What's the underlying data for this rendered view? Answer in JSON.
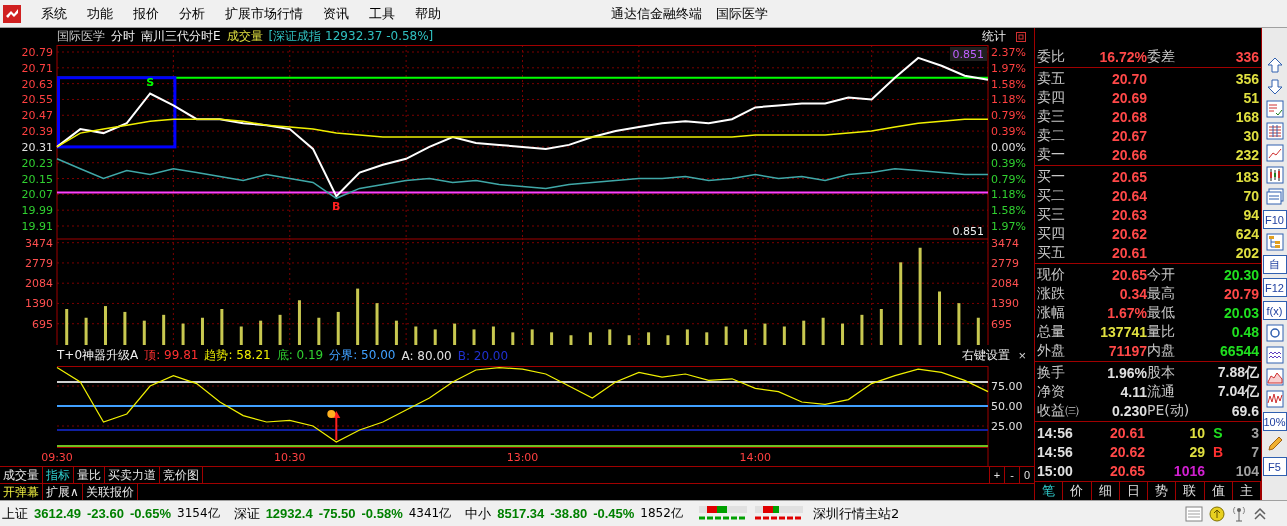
{
  "menu": {
    "items": [
      "系统",
      "功能",
      "报价",
      "分析",
      "扩展市场行情",
      "资讯",
      "工具",
      "帮助"
    ],
    "title": "通达信金融终端",
    "stock": "国际医学"
  },
  "chart_header": {
    "stock": "国际医学",
    "mode": "分时",
    "indicator": "南川三代分时E",
    "volume_label": "成交量",
    "index_overlay": "[深证成指 12932.37 -0.58%]",
    "stats_label": "统计"
  },
  "price_chart": {
    "top_reading": "0.851",
    "bottom_reading": "0.851",
    "pct_ticks": [
      {
        "label": "2.37%",
        "color": "#ff4040"
      },
      {
        "label": "1.97%",
        "color": "#ff4040"
      },
      {
        "label": "1.58%",
        "color": "#ff4040"
      },
      {
        "label": "1.18%",
        "color": "#ff4040"
      },
      {
        "label": "0.79%",
        "color": "#ff4040"
      },
      {
        "label": "0.39%",
        "color": "#ff4040"
      },
      {
        "label": "0.00%",
        "color": "#e0e0e0"
      },
      {
        "label": "0.39%",
        "color": "#30d030"
      },
      {
        "label": "0.79%",
        "color": "#30d030"
      },
      {
        "label": "1.18%",
        "color": "#30d030"
      },
      {
        "label": "1.58%",
        "color": "#30d030"
      },
      {
        "label": "1.97%",
        "color": "#30d030"
      }
    ],
    "signals": [
      {
        "label": "S",
        "color": "#00ff00"
      },
      {
        "label": "B",
        "color": "#ff2020"
      }
    ],
    "chart_data": {
      "type": "line",
      "grid": true,
      "categories": [
        null,
        null,
        null,
        null,
        null,
        null,
        null,
        null,
        null,
        null,
        null,
        null,
        null,
        null,
        null,
        null,
        null,
        null,
        null,
        null,
        null,
        null,
        null,
        null,
        null,
        null,
        null,
        null,
        null,
        null,
        null,
        null,
        null,
        null,
        null,
        null,
        null,
        null,
        null,
        null,
        null
      ],
      "ylim": [
        19.91,
        20.79
      ],
      "yticks": [
        {
          "value": 20.79,
          "label": "20.79"
        },
        {
          "value": 20.71,
          "label": "20.71"
        },
        {
          "value": 20.63,
          "label": "20.63"
        },
        {
          "value": 20.55,
          "label": "20.55"
        },
        {
          "value": 20.47,
          "label": "20.47"
        },
        {
          "value": 20.39,
          "label": "20.39"
        },
        {
          "value": 20.31,
          "label": "20.31"
        },
        {
          "value": 20.23,
          "label": "20.23"
        },
        {
          "value": 20.15,
          "label": "20.15"
        },
        {
          "value": 20.07,
          "label": "20.07"
        },
        {
          "value": 19.99,
          "label": "19.99"
        },
        {
          "value": 19.91,
          "label": "19.91"
        }
      ],
      "series": [
        {
          "color": "#ffffff",
          "values": [
            20.31,
            20.4,
            20.38,
            20.43,
            20.58,
            20.52,
            20.45,
            20.45,
            20.43,
            20.42,
            20.4,
            20.3,
            20.06,
            20.18,
            20.22,
            20.25,
            20.31,
            20.36,
            20.33,
            20.32,
            20.31,
            20.3,
            20.32,
            20.36,
            20.39,
            20.41,
            20.43,
            20.44,
            20.43,
            20.45,
            20.51,
            20.52,
            20.53,
            20.53,
            20.56,
            20.55,
            20.66,
            20.76,
            20.72,
            20.67,
            20.65
          ]
        },
        {
          "color": "#f0f000",
          "values": [
            20.31,
            20.38,
            20.4,
            20.42,
            20.44,
            20.45,
            20.45,
            20.45,
            20.44,
            20.42,
            20.41,
            20.4,
            20.38,
            20.37,
            20.36,
            20.36,
            20.36,
            20.36,
            20.36,
            20.36,
            20.36,
            20.36,
            20.36,
            20.36,
            20.36,
            20.36,
            20.36,
            20.36,
            20.36,
            20.36,
            20.37,
            20.37,
            20.37,
            20.37,
            20.38,
            20.39,
            20.41,
            20.43,
            20.44,
            20.45,
            20.45
          ]
        },
        {
          "color": "#40a8a8",
          "values": [
            20.25,
            20.2,
            20.15,
            20.19,
            20.17,
            20.2,
            20.18,
            20.16,
            20.14,
            20.17,
            20.15,
            20.13,
            20.05,
            20.1,
            20.12,
            20.14,
            20.15,
            20.13,
            20.14,
            20.12,
            20.11,
            20.1,
            20.12,
            20.13,
            20.14,
            20.15,
            20.15,
            20.16,
            20.14,
            20.15,
            20.17,
            20.15,
            20.16,
            20.14,
            20.17,
            20.18,
            20.2,
            20.19,
            20.18,
            20.17,
            20.17
          ]
        }
      ],
      "ref_lines": [
        {
          "axis": "y",
          "value": 20.66,
          "color": "#00ff00"
        },
        {
          "axis": "y",
          "value": 20.08,
          "color": "#ff40ff"
        }
      ]
    }
  },
  "volume_chart": {
    "right_ticks": [
      "3474",
      "2779",
      "2084",
      "1390",
      "695"
    ],
    "chart_data": {
      "type": "bar",
      "grid": true,
      "categories": [
        null,
        null,
        null,
        null,
        null,
        null,
        null,
        null,
        null,
        null,
        null,
        null,
        null,
        null,
        null,
        null,
        null,
        null,
        null,
        null,
        null,
        null,
        null,
        null,
        null,
        null,
        null,
        null,
        null,
        null,
        null,
        null,
        null,
        null,
        null,
        null,
        null,
        null,
        null,
        null,
        null,
        null,
        null,
        null,
        null,
        null,
        null,
        null
      ],
      "ylim": [
        0,
        3600
      ],
      "yticks": [
        {
          "value": 3474,
          "label": "3474"
        },
        {
          "value": 2779,
          "label": "2779"
        },
        {
          "value": 2084,
          "label": "2084"
        },
        {
          "value": 1390,
          "label": "1390"
        },
        {
          "value": 695,
          "label": "695"
        }
      ],
      "series": [
        {
          "color": "#c8c850",
          "values": [
            1200,
            900,
            1300,
            1100,
            800,
            1000,
            700,
            900,
            1200,
            600,
            800,
            1000,
            1500,
            900,
            1100,
            1900,
            1400,
            800,
            600,
            500,
            700,
            500,
            600,
            400,
            500,
            400,
            300,
            400,
            500,
            300,
            400,
            300,
            500,
            400,
            600,
            500,
            700,
            600,
            800,
            900,
            700,
            1000,
            1200,
            2800,
            3300,
            1800,
            1400,
            900
          ]
        }
      ]
    }
  },
  "indicator": {
    "title": "T+0神器升级A",
    "readings": [
      {
        "label": "顶:",
        "value": "99.81",
        "color": "#ff3030"
      },
      {
        "label": "趋势:",
        "value": "58.21",
        "color": "#f0f000"
      },
      {
        "label": "底:",
        "value": "0.19",
        "color": "#30d030"
      },
      {
        "label": "分界:",
        "value": "50.00",
        "color": "#40a0ff"
      },
      {
        "label": "A:",
        "value": "80.00",
        "color": "#e0e0e0"
      },
      {
        "label": "B:",
        "value": "20.00",
        "color": "#2030d0"
      }
    ],
    "settings": "右键设置",
    "close": "×",
    "chart_data": {
      "type": "line",
      "grid": true,
      "categories": [
        "09:30",
        null,
        null,
        null,
        null,
        null,
        null,
        null,
        null,
        null,
        "10:30",
        null,
        null,
        null,
        null,
        null,
        null,
        null,
        null,
        null,
        "13:00",
        null,
        null,
        null,
        null,
        null,
        null,
        null,
        null,
        null,
        "14:00",
        null,
        null,
        null,
        null,
        null,
        null,
        null,
        null,
        null,
        null
      ],
      "ylim": [
        0,
        100
      ],
      "yticks": [
        {
          "value": 75,
          "label": "75.00"
        },
        {
          "value": 50,
          "label": "50.00"
        },
        {
          "value": 25,
          "label": "25.00"
        }
      ],
      "series": [
        {
          "color": "#f0f000",
          "values": [
            98,
            80,
            30,
            40,
            75,
            88,
            78,
            55,
            38,
            30,
            32,
            25,
            5,
            20,
            30,
            45,
            60,
            80,
            95,
            98,
            96,
            90,
            75,
            60,
            80,
            92,
            86,
            90,
            82,
            84,
            72,
            68,
            55,
            52,
            58,
            78,
            88,
            96,
            92,
            82,
            68
          ]
        }
      ],
      "ref_lines": [
        {
          "axis": "y",
          "value": 80,
          "color": "#d0d0d0"
        },
        {
          "axis": "y",
          "value": 50,
          "color": "#40a0ff"
        },
        {
          "axis": "y",
          "value": 20,
          "color": "#1020a0"
        },
        {
          "axis": "y",
          "value": 0,
          "color": "#70c020"
        }
      ]
    }
  },
  "zoom_buttons": [
    "+",
    "-",
    "0"
  ],
  "bottom_tabs": [
    {
      "label": "成交量",
      "selected": false
    },
    {
      "label": "指标",
      "selected": true
    },
    {
      "label": "量比",
      "selected": false
    },
    {
      "label": "买卖力道",
      "selected": false
    },
    {
      "label": "竞价图",
      "selected": false
    }
  ],
  "extra_tabs": [
    {
      "label": "开弹幕",
      "on": true
    },
    {
      "label": "扩展∧",
      "on": false
    },
    {
      "label": "关联报价",
      "on": false
    }
  ],
  "order_ratio": {
    "label": "委比",
    "value": "16.72%",
    "diff_label": "委差",
    "diff": "336"
  },
  "asks": [
    {
      "label": "卖五",
      "price": "20.70",
      "volume": "356"
    },
    {
      "label": "卖四",
      "price": "20.69",
      "volume": "51"
    },
    {
      "label": "卖三",
      "price": "20.68",
      "volume": "168"
    },
    {
      "label": "卖二",
      "price": "20.67",
      "volume": "30"
    },
    {
      "label": "卖一",
      "price": "20.66",
      "volume": "232"
    }
  ],
  "bids": [
    {
      "label": "买一",
      "price": "20.65",
      "volume": "183"
    },
    {
      "label": "买二",
      "price": "20.64",
      "volume": "70"
    },
    {
      "label": "买三",
      "price": "20.63",
      "volume": "94"
    },
    {
      "label": "买四",
      "price": "20.62",
      "volume": "624"
    },
    {
      "label": "买五",
      "price": "20.61",
      "volume": "202"
    }
  ],
  "quote": [
    {
      "label": "现价",
      "value": "20.65",
      "color": "#ff4848"
    },
    {
      "label": "今开",
      "value": "20.30",
      "color": "#20e020"
    },
    {
      "label": "涨跌",
      "value": "0.34",
      "color": "#ff4848"
    },
    {
      "label": "最高",
      "value": "20.79",
      "color": "#ff4848"
    },
    {
      "label": "涨幅",
      "value": "1.67%",
      "color": "#ff4848"
    },
    {
      "label": "最低",
      "value": "20.03",
      "color": "#20e020"
    },
    {
      "label": "总量",
      "value": "137741",
      "color": "#e0e040"
    },
    {
      "label": "量比",
      "value": "0.48",
      "color": "#20e020"
    },
    {
      "label": "外盘",
      "value": "71197",
      "color": "#ff4848"
    },
    {
      "label": "内盘",
      "value": "66544",
      "color": "#20e020"
    }
  ],
  "stats": [
    {
      "label": "换手",
      "value": "1.96%",
      "label2": "股本",
      "value2": "7.88亿"
    },
    {
      "label": "净资",
      "value": "4.11",
      "label2": "流通",
      "value2": "7.04亿"
    },
    {
      "label": "收益㈢",
      "value": "0.230",
      "label2": "PE(动)",
      "value2": "69.6"
    }
  ],
  "ticks": [
    {
      "time": "14:56",
      "price": "20.61",
      "volume": "10",
      "large": false,
      "side": "S",
      "color": "#20e020",
      "count": "3"
    },
    {
      "time": "14:56",
      "price": "20.62",
      "volume": "29",
      "large": false,
      "side": "B",
      "color": "#ff3030",
      "count": "7"
    },
    {
      "time": "15:00",
      "price": "20.65",
      "volume": "1016",
      "large": true,
      "count": "104"
    }
  ],
  "panel_tabs": [
    {
      "label": "笔",
      "selected": true
    },
    {
      "label": "价",
      "selected": false
    },
    {
      "label": "细",
      "selected": false
    },
    {
      "label": "日",
      "selected": false
    },
    {
      "label": "势",
      "selected": false
    },
    {
      "label": "联",
      "selected": false
    },
    {
      "label": "值",
      "selected": false
    },
    {
      "label": "主",
      "selected": false
    }
  ],
  "toolbar": [
    {
      "kind": "up-arrow"
    },
    {
      "kind": "down-arrow"
    },
    {
      "kind": "checklist"
    },
    {
      "kind": "grid"
    },
    {
      "kind": "line"
    },
    {
      "kind": "candles"
    },
    {
      "kind": "window"
    },
    {
      "kind": "text",
      "label": "F10"
    },
    {
      "kind": "tree"
    },
    {
      "kind": "text",
      "label": "自"
    },
    {
      "kind": "text",
      "label": "F12"
    },
    {
      "kind": "text",
      "label": "f(x)"
    },
    {
      "kind": "circle"
    },
    {
      "kind": "wave"
    },
    {
      "kind": "area"
    },
    {
      "kind": "zigzag"
    },
    {
      "kind": "text",
      "label": "10%"
    },
    {
      "kind": "pencil"
    },
    {
      "kind": "text",
      "label": "F5"
    }
  ],
  "status_bar": {
    "indexes": [
      {
        "name": "上证",
        "value": "3612.49",
        "change": "-23.60",
        "pct": "-0.65%",
        "amount": "3154亿",
        "color": "#008000"
      },
      {
        "name": "深证",
        "value": "12932.4",
        "change": "-75.50",
        "pct": "-0.58%",
        "amount": "4341亿",
        "color": "#008000"
      },
      {
        "name": "中小",
        "value": "8517.34",
        "change": "-38.80",
        "pct": "-0.45%",
        "amount": "1852亿",
        "color": "#008000"
      }
    ],
    "server": "深圳行情主站2"
  }
}
